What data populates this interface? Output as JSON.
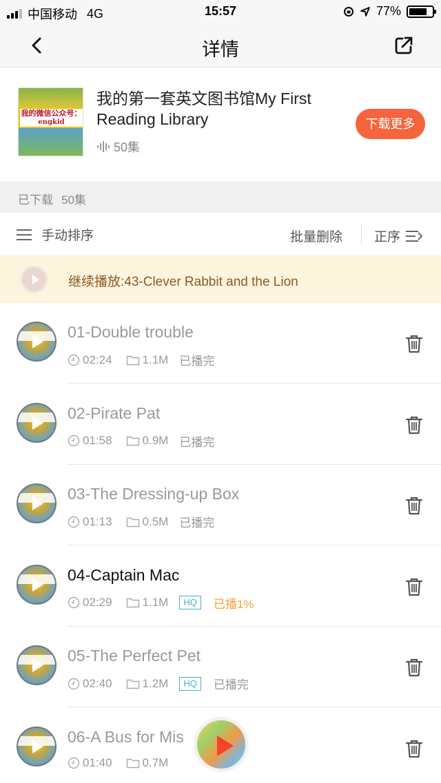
{
  "status_bar": {
    "carrier": "中国移动",
    "network": "4G",
    "time": "15:57",
    "battery_text": "77%",
    "battery_level": 0.77
  },
  "nav": {
    "title": "详情",
    "back_icon": "chevron-left-icon",
    "share_icon": "share-icon"
  },
  "album": {
    "cover_text": "我的微信公众号：",
    "cover_sub": "engkid",
    "title": "我的第一套英文图书馆My First Reading Library",
    "episode_count": "50集",
    "download_more": "下载更多",
    "accent": "#f5643c"
  },
  "downloaded": {
    "label": "已下载",
    "count": "50集"
  },
  "toolbar": {
    "sort_manual": "手动排序",
    "batch_delete": "批量删除",
    "order": "正序"
  },
  "continue_play": {
    "text": "继续播放:43-Clever Rabbit and the Lion"
  },
  "episodes": [
    {
      "title": "01-Double trouble",
      "duration": "02:24",
      "size": "1.1M",
      "hq": "",
      "status": "已播完",
      "active": false
    },
    {
      "title": "02-Pirate Pat",
      "duration": "01:58",
      "size": "0.9M",
      "hq": "",
      "status": "已播完",
      "active": false
    },
    {
      "title": "03-The Dressing-up Box",
      "duration": "01:13",
      "size": "0.5M",
      "hq": "",
      "status": "已播完",
      "active": false
    },
    {
      "title": "04-Captain Mac",
      "duration": "02:29",
      "size": "1.1M",
      "hq": "HQ",
      "status": "已播1%",
      "active": true
    },
    {
      "title": "05-The Perfect Pet",
      "duration": "02:40",
      "size": "1.2M",
      "hq": "HQ",
      "status": "已播完",
      "active": false
    },
    {
      "title": "06-A Bus for Mis",
      "duration": "01:40",
      "size": "0.7M",
      "hq": "",
      "status": "",
      "active": false
    }
  ],
  "colors": {
    "hq": "#3fb5c9",
    "played_partial": "#f5a33a",
    "banner_bg": "#fdf4dd"
  }
}
